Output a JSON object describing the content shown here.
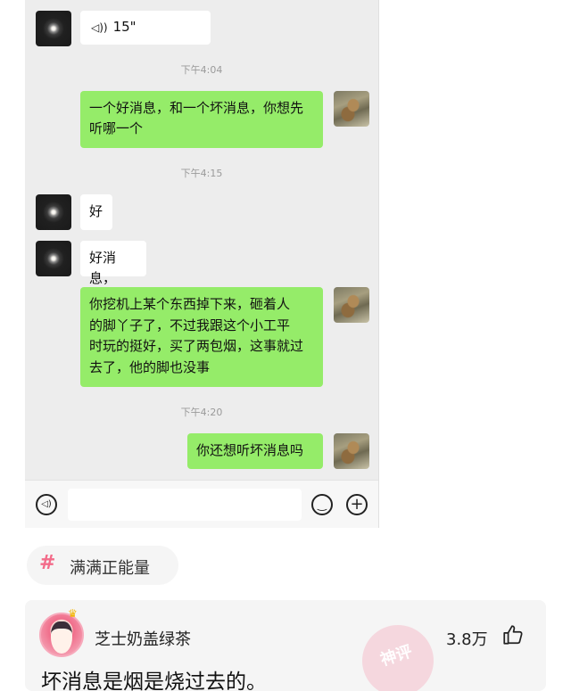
{
  "chat": {
    "voice_message": {
      "duration": "15\"",
      "icon": "voice-wave-icon"
    },
    "timestamps": [
      "下午4:04",
      "下午4:15",
      "下午4:20"
    ],
    "messages": [
      {
        "side": "right",
        "text_lines": [
          "一个好消息，和一个坏消息，你想先",
          "听哪一个"
        ]
      },
      {
        "side": "left",
        "text": "好"
      },
      {
        "side": "left",
        "text": "好消息，"
      },
      {
        "side": "right",
        "text_lines": [
          "你挖机上某个东西掉下来，砸着人",
          "的脚丫子了，不过我跟这个小工平",
          "时玩的挺好，买了两包烟，这事就过",
          "去了，他的脚也没事"
        ]
      },
      {
        "side": "right",
        "text": "你还想听坏消息吗"
      }
    ],
    "input_bar": {
      "voice_button_icon": "voice-toggle-icon",
      "emoji_button_icon": "emoji-icon",
      "plus_button_icon": "plus-icon"
    }
  },
  "topic": {
    "label": "满满正能量",
    "icon": "hashtag-icon"
  },
  "comment": {
    "username": "芝士奶盖绿茶",
    "likes": "3.8万",
    "text": "坏消息是烟是烧过去的。",
    "badge": "神评",
    "like_icon": "thumbs-up-icon"
  }
}
